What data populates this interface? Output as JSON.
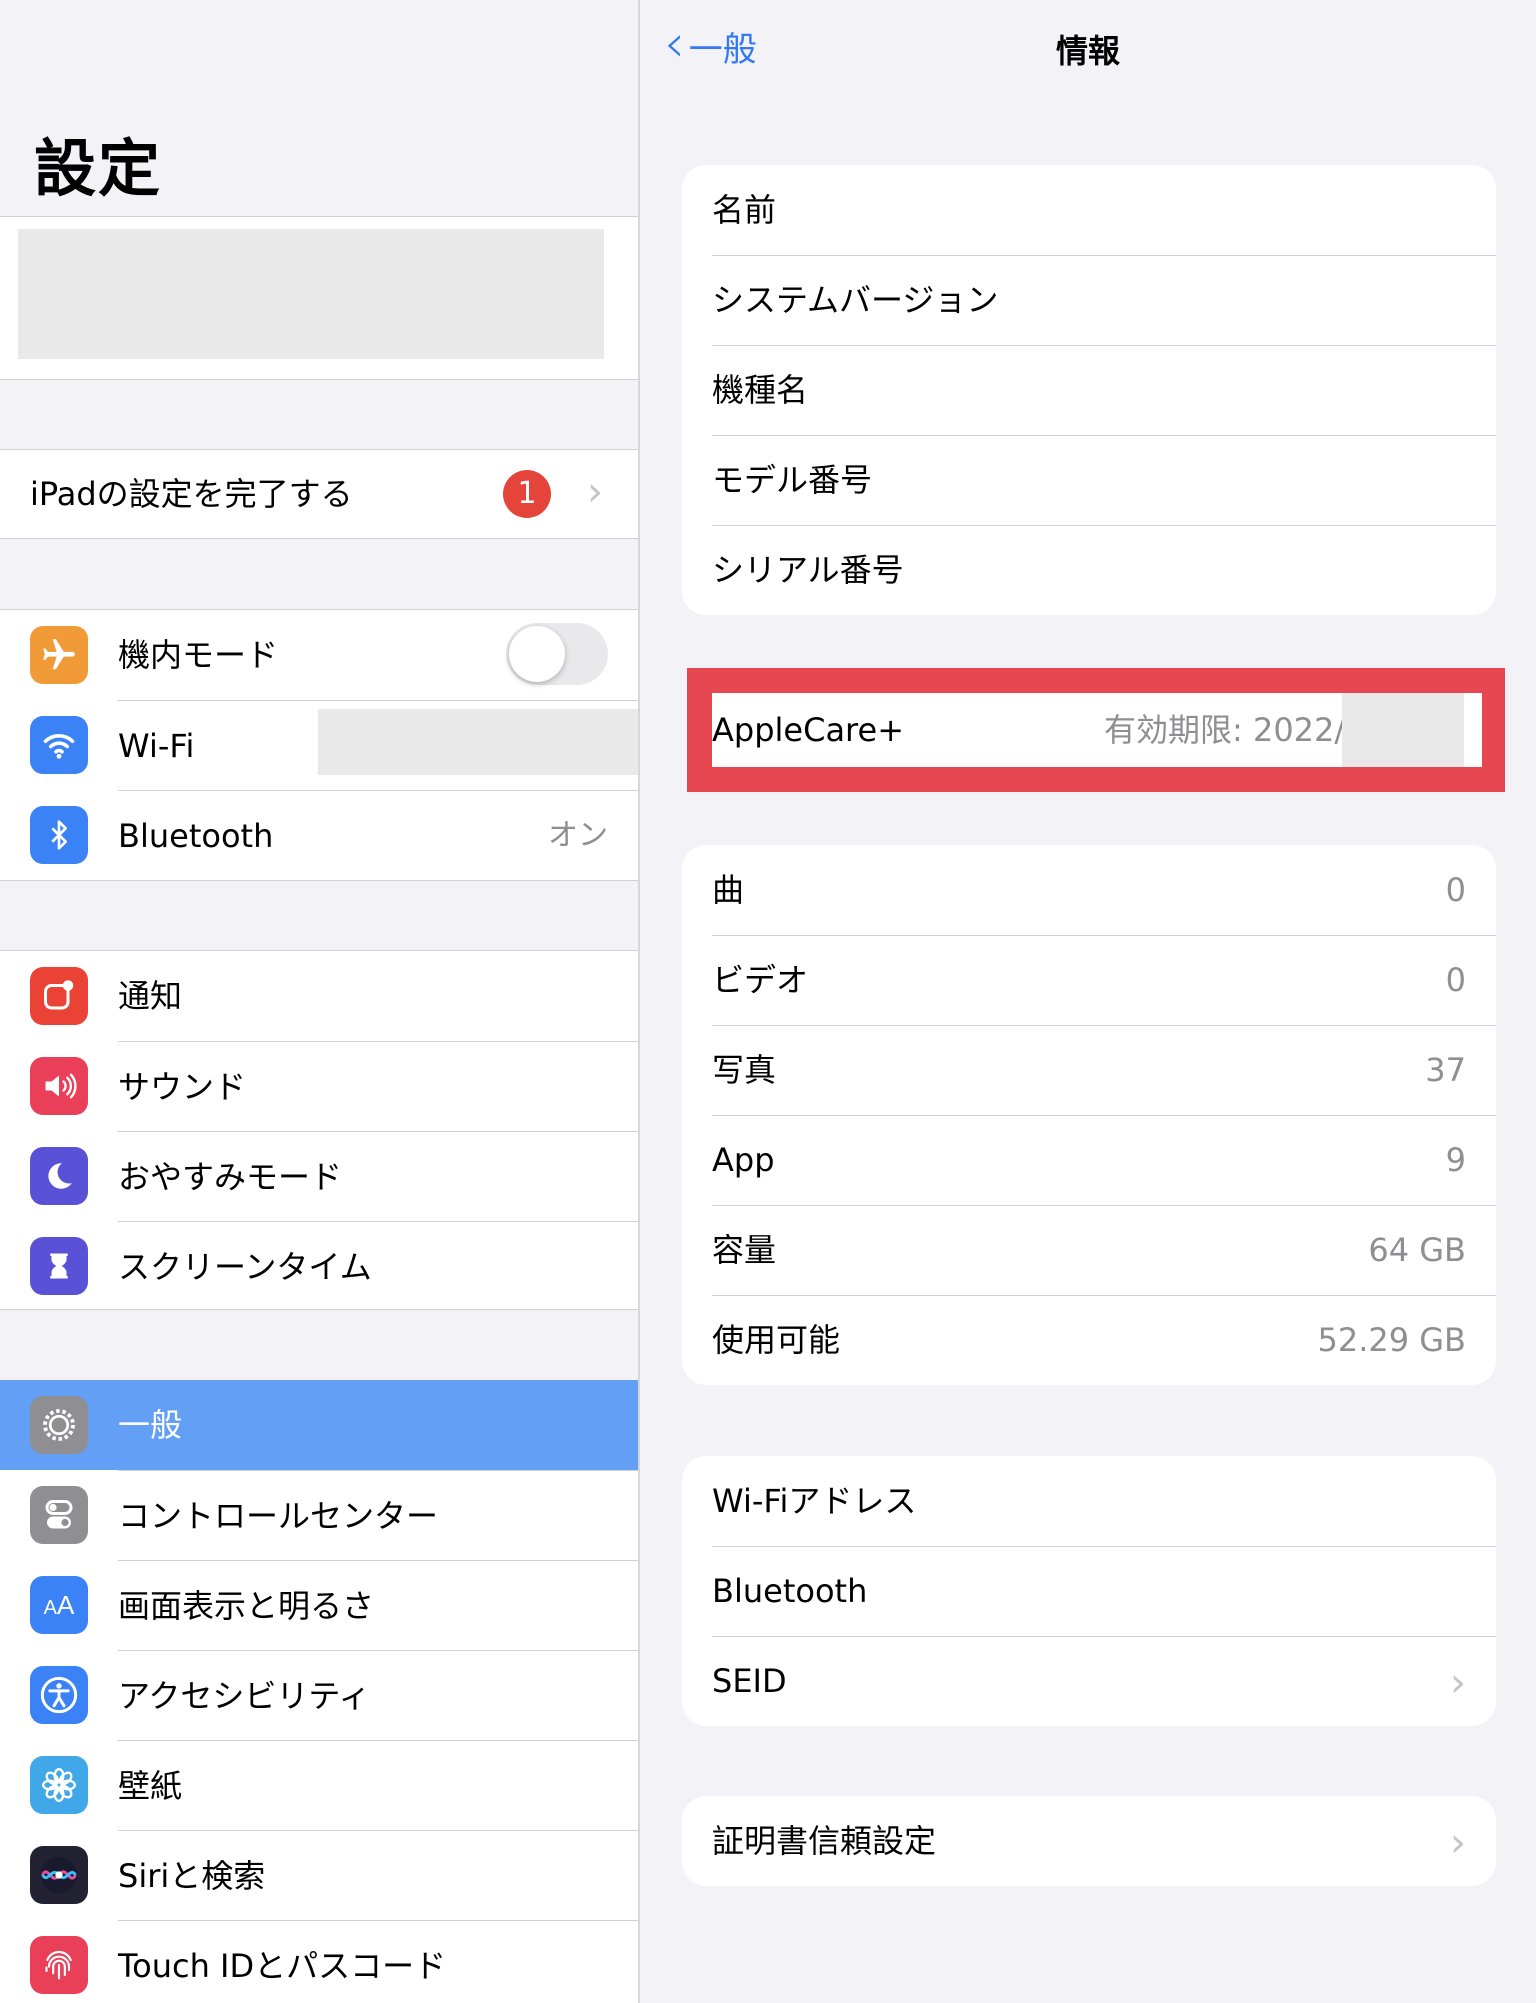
{
  "sidebar": {
    "title": "設定",
    "setup": {
      "label": "iPadの設定を完了する",
      "badge": "1"
    },
    "connectivity": [
      {
        "label": "機内モード",
        "icon": "airplane-icon",
        "color": "#f19a38"
      },
      {
        "label": "Wi-Fi",
        "icon": "wifi-icon",
        "color": "#3a82f6"
      },
      {
        "label": "Bluetooth",
        "value": "オン",
        "icon": "bluetooth-icon",
        "color": "#3a82f6"
      }
    ],
    "notifications": [
      {
        "label": "通知",
        "icon": "notifications-icon",
        "color": "#ea4335"
      },
      {
        "label": "サウンド",
        "icon": "speaker-icon",
        "color": "#ea3f58"
      },
      {
        "label": "おやすみモード",
        "icon": "moon-icon",
        "color": "#5a52d6"
      },
      {
        "label": "スクリーンタイム",
        "icon": "hourglass-icon",
        "color": "#5a52d6"
      }
    ],
    "general": [
      {
        "label": "一般",
        "icon": "gear-icon",
        "color": "#8e8e93",
        "selected": true
      },
      {
        "label": "コントロールセンター",
        "icon": "toggles-icon",
        "color": "#8e8e93"
      },
      {
        "label": "画面表示と明るさ",
        "icon": "text-size-icon",
        "color": "#3a82f6"
      },
      {
        "label": "アクセシビリティ",
        "icon": "accessibility-icon",
        "color": "#3a82f6"
      },
      {
        "label": "壁紙",
        "icon": "flower-icon",
        "color": "#40a8e8"
      },
      {
        "label": "Siriと検索",
        "icon": "siri-icon",
        "color": "#222233"
      },
      {
        "label": "Touch IDとパスコード",
        "icon": "fingerprint-icon",
        "color": "#ea3f58"
      }
    ]
  },
  "detail": {
    "back_label": "一般",
    "title": "情報",
    "identity": [
      "名前",
      "システムバージョン",
      "機種名",
      "モデル番号",
      "シリアル番号"
    ],
    "applecare": {
      "label": "AppleCare+",
      "value": "有効期限: 2022/"
    },
    "media": [
      {
        "label": "曲",
        "value": "0"
      },
      {
        "label": "ビデオ",
        "value": "0"
      },
      {
        "label": "写真",
        "value": "37"
      },
      {
        "label": "App",
        "value": "9"
      },
      {
        "label": "容量",
        "value": "64 GB"
      },
      {
        "label": "使用可能",
        "value": "52.29 GB"
      }
    ],
    "network": [
      {
        "label": "Wi-Fiアドレス"
      },
      {
        "label": "Bluetooth"
      },
      {
        "label": "SEID",
        "chevron": true
      }
    ],
    "certificate": {
      "label": "証明書信頼設定"
    }
  }
}
